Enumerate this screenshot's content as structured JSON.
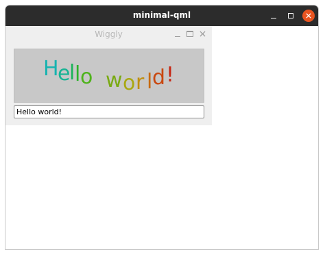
{
  "window": {
    "title": "minimal-qml",
    "close_color": "#e95420"
  },
  "dialog": {
    "title": "Wiggly",
    "wiggly_letters": [
      "H",
      "e",
      "l",
      "l",
      "o",
      " ",
      "w",
      "o",
      "r",
      "l",
      "d",
      "!"
    ],
    "letter_colors": [
      "#17b3b0",
      "#17b394",
      "#1bb35a",
      "#2bb32a",
      "#4fb31c",
      "#ffffff",
      "#7aaa14",
      "#a9a812",
      "#bf8f10",
      "#c76a10",
      "#c94810",
      "#c62512"
    ],
    "input_value": "Hello world!"
  }
}
